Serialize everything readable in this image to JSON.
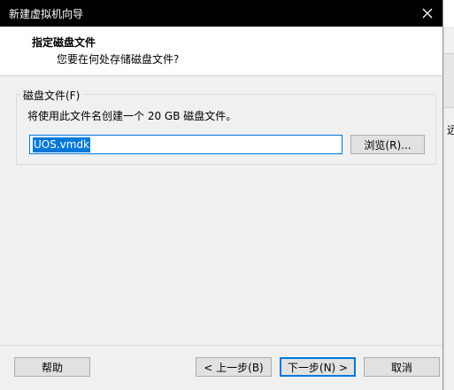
{
  "window": {
    "title": "新建虚拟机向导"
  },
  "header": {
    "title": "指定磁盘文件",
    "subtitle": "您要在何处存储磁盘文件?"
  },
  "disk_file": {
    "group_label": "磁盘文件(F)",
    "description": "将使用此文件名创建一个 20 GB 磁盘文件。",
    "file_name": "UOS.vmdk",
    "browse_label": "浏览(R)..."
  },
  "footer": {
    "help_label": "帮助",
    "back_label": "< 上一步(B)",
    "next_label": "下一步(N) >",
    "cancel_label": "取消"
  },
  "background_window": {
    "edge_text": "远"
  }
}
